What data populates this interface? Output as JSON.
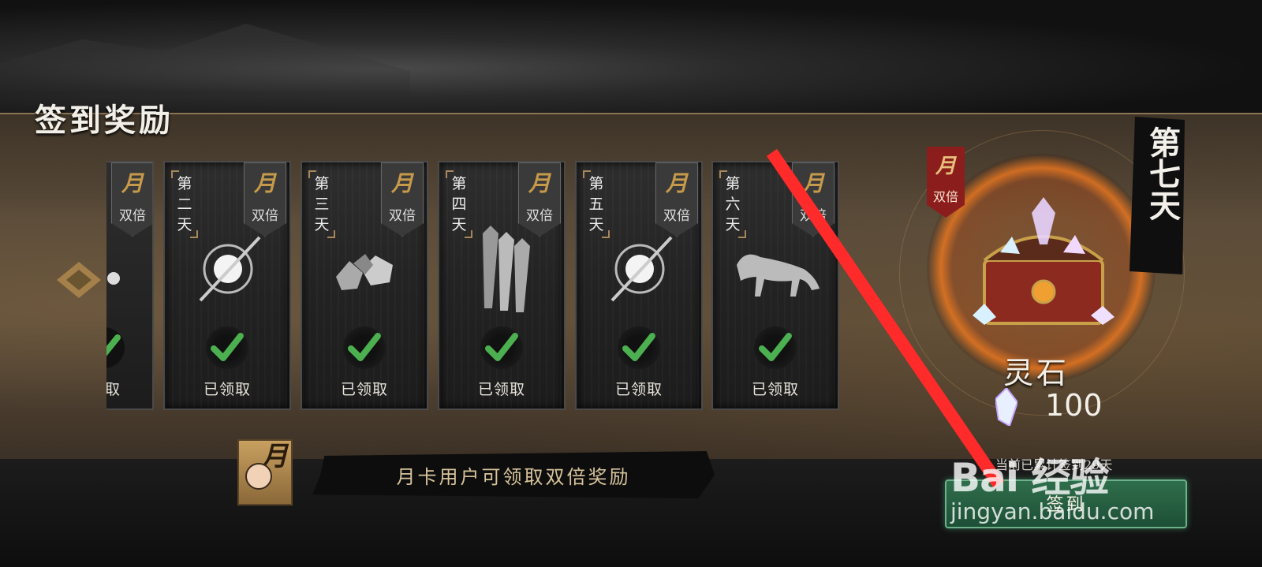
{
  "page": {
    "title": "签到奖励"
  },
  "cards": [
    {
      "day": "",
      "double": "双倍",
      "claimed": "取"
    },
    {
      "day": "第二天",
      "double": "双倍",
      "claimed": "已领取"
    },
    {
      "day": "第三天",
      "double": "双倍",
      "claimed": "已领取"
    },
    {
      "day": "第四天",
      "double": "双倍",
      "claimed": "已领取"
    },
    {
      "day": "第五天",
      "double": "双倍",
      "claimed": "已领取"
    },
    {
      "day": "第六天",
      "double": "双倍",
      "claimed": "已领取"
    }
  ],
  "monthcard_glyph": "月卡",
  "day7": {
    "label": "第七天",
    "double": "双倍",
    "reward_name": "灵石",
    "amount": "100"
  },
  "monthcard": {
    "text": "月卡用户可领取双倍奖励"
  },
  "checkin": {
    "hint": "当前已累计签到29天",
    "button": "签到"
  },
  "watermark": {
    "logo": "Bai 经验",
    "url": "jingyan.baidu.com"
  },
  "colors": {
    "band": "#5a4b39",
    "check_green": "#4caf50",
    "button_green": "#2f6e4c",
    "arrow_red": "#ff2a2a",
    "ring_orange": "#f07820"
  }
}
